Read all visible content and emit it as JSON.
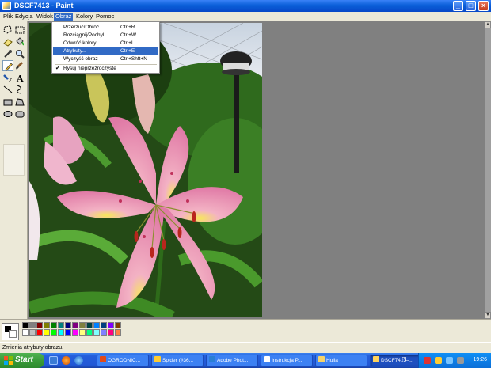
{
  "window": {
    "title": "DSCF7413 - Paint",
    "controls": {
      "minimize": "_",
      "maximize": "□",
      "close": "×"
    }
  },
  "menubar": {
    "items": [
      "Plik",
      "Edycja",
      "Widok",
      "Obraz",
      "Kolory",
      "Pomoc"
    ],
    "active": "Obraz"
  },
  "dropdown": {
    "items": [
      {
        "label": "Przerzuć/Obróć...",
        "shortcut": "Ctrl+R"
      },
      {
        "label": "Rozciągnij/Pochyl...",
        "shortcut": "Ctrl+W"
      },
      {
        "label": "Odwróć kolory",
        "shortcut": "Ctrl+I"
      },
      {
        "label": "Atrybuty...",
        "shortcut": "Ctrl+E",
        "highlighted": true
      },
      {
        "label": "Wyczyść obraz",
        "shortcut": "Ctrl+Shft+N"
      },
      {
        "label": "Rysuj nieprzezroczyste",
        "shortcut": "",
        "checked": true,
        "check_mark": "✔"
      }
    ]
  },
  "toolbox": {
    "tools": [
      "free-select",
      "rect-select",
      "eraser",
      "fill",
      "color-picker",
      "magnifier",
      "pencil",
      "brush",
      "airbrush",
      "text",
      "line",
      "curve",
      "rectangle",
      "polygon",
      "ellipse",
      "rounded-rectangle"
    ],
    "selected": "pencil"
  },
  "palette": {
    "foreground": "#000000",
    "background": "#ffffff",
    "colors_top": [
      "#000000",
      "#808080",
      "#800000",
      "#808000",
      "#008000",
      "#008080",
      "#000080",
      "#800080",
      "#808040",
      "#004040",
      "#0080ff",
      "#004080",
      "#8000ff",
      "#804000"
    ],
    "colors_bottom": [
      "#ffffff",
      "#c0c0c0",
      "#ff0000",
      "#ffff00",
      "#00ff00",
      "#00ffff",
      "#0000ff",
      "#ff00ff",
      "#ffff80",
      "#00ff80",
      "#80ffff",
      "#8080ff",
      "#ff0080",
      "#ff8040"
    ]
  },
  "statusbar": {
    "text": "Zmienia atrybuty obrazu."
  },
  "taskbar": {
    "start_label": "Start",
    "tasks": [
      {
        "label": "OGRODNIC...",
        "color": "#e04a1a"
      },
      {
        "label": "Spider (#36...",
        "color": "#ffcc33"
      },
      {
        "label": "Adobe Phot...",
        "color": "#2a7fd4"
      },
      {
        "label": "Instrukcja P...",
        "color": "#ffffff"
      },
      {
        "label": "Hulia",
        "color": "#f5d36b"
      },
      {
        "label": "DSCF7413 -...",
        "color": "#ffd35c",
        "active": true
      }
    ],
    "language": "PL",
    "clock": "19:26"
  }
}
